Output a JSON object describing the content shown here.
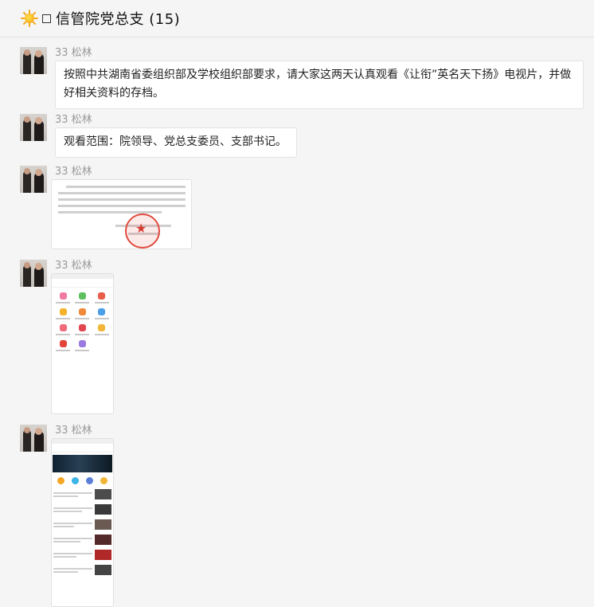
{
  "header": {
    "title": "信管院党总支 (15)"
  },
  "messages": [
    {
      "sender": "33 松林",
      "text": "按照中共湖南省委组织部及学校组织部要求，请大家这两天认真观看《让衔”英名天下扬》电视片，并做好相关资料的存档。"
    },
    {
      "sender": "33 松林",
      "text": "观看范围：院领导、党总支委员、支部书记。"
    },
    {
      "sender": "33 松林",
      "image": "notice-document-with-red-seal"
    },
    {
      "sender": "33 松林",
      "image": "phone-app-screenshot-icon-grid"
    },
    {
      "sender": "33 松林",
      "image": "phone-app-screenshot-news-list"
    }
  ],
  "colors": {
    "seal": "#e04a3e",
    "background": "#f5f5f5",
    "bubble": "#ffffff"
  }
}
